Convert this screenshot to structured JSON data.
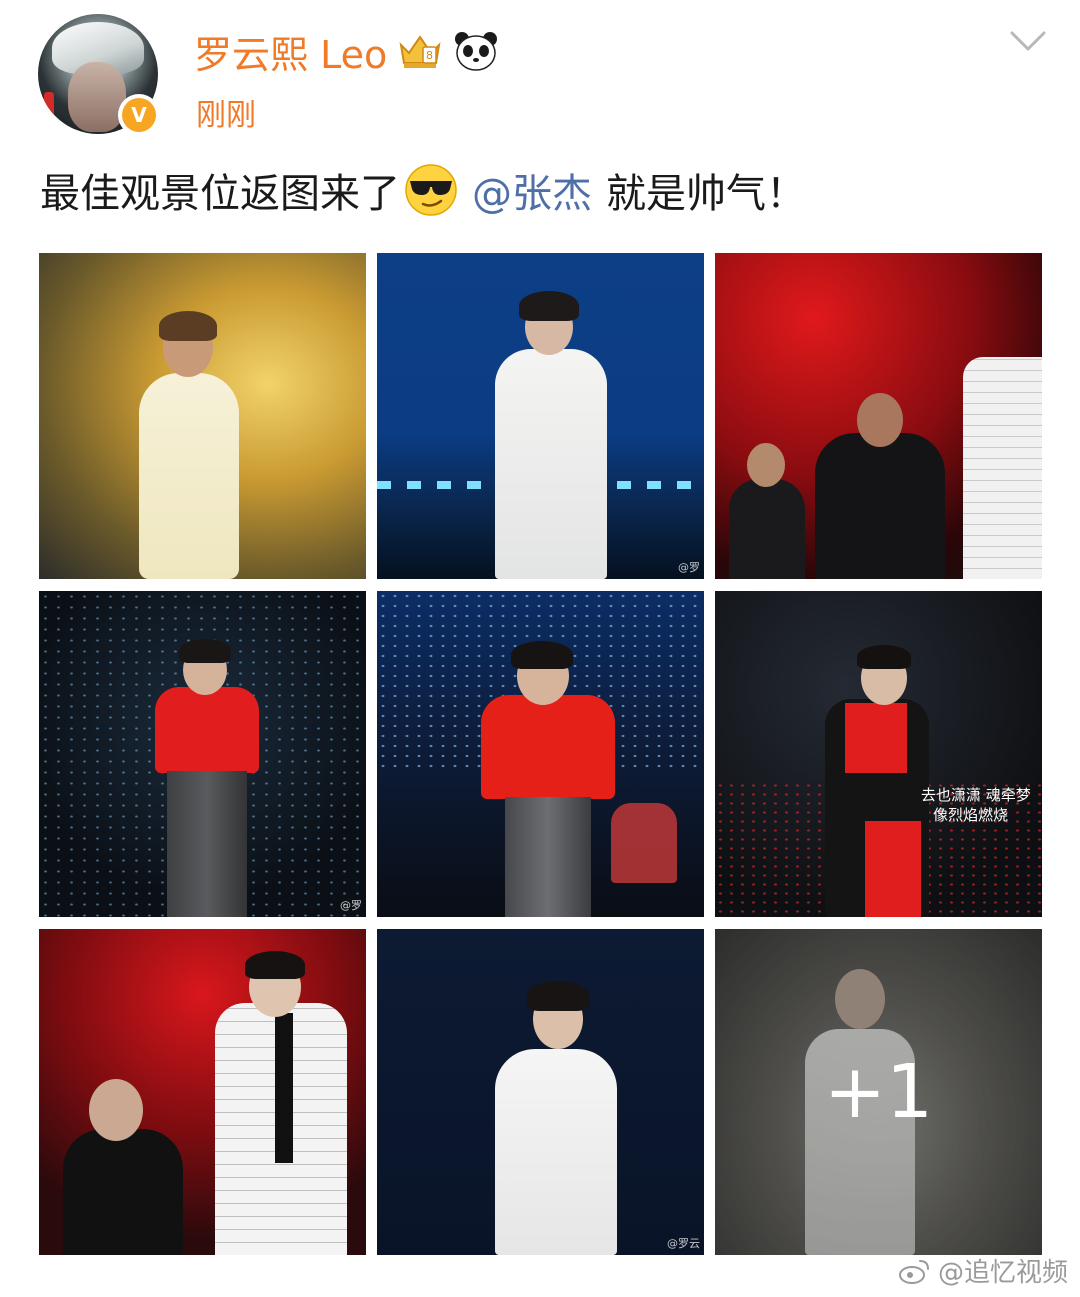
{
  "user": {
    "name": "罗云熙 Leo",
    "time": "刚刚",
    "verified_badge": "V"
  },
  "post": {
    "text_before": "最佳观景位返图来了",
    "mention": "@张杰",
    "text_after": "就是帅气！"
  },
  "photos": [
    {
      "desc": "yellow-smoke-white-suit"
    },
    {
      "desc": "blue-stage-white-suit",
      "watermark": "@罗"
    },
    {
      "desc": "red-lights-dancers"
    },
    {
      "desc": "red-shirt-sparkle-crowd",
      "watermark": "@罗"
    },
    {
      "desc": "red-shirt-blue-lights"
    },
    {
      "desc": "red-shirt-black-coat",
      "lyric_line1": "去也潇潇 魂牵梦",
      "lyric_line2": "像烈焰燃烧"
    },
    {
      "desc": "plaid-jacket-red-lights"
    },
    {
      "desc": "white-suit-navy-bg",
      "watermark": "@罗云"
    },
    {
      "desc": "smoke-white-suit",
      "more_count": "+1"
    }
  ],
  "footer_watermark": "@追忆视频",
  "colors": {
    "accent": "#f07a28",
    "link": "#4f6fa8",
    "text": "#1a1a1a"
  }
}
